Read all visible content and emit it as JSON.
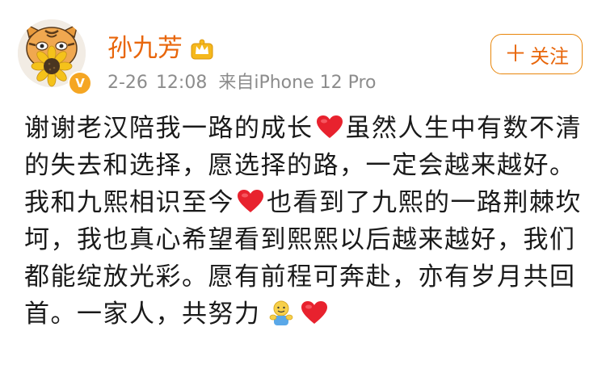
{
  "post": {
    "user": {
      "name": "孙九芳",
      "badge_icon": "crown-icon",
      "verified_icon": "v-badge-icon",
      "verified_label": "V"
    },
    "meta": {
      "date": "2-26",
      "time": "12:08",
      "source": "来自iPhone 12 Pro"
    },
    "follow_button": {
      "plus": "＋",
      "label": "关注"
    },
    "content": {
      "para1_a": "谢谢老汉陪我一路的成长",
      "para1_b": "虽然人生中有数不清的失去和选择，愿选择的路，一定会越来越好。",
      "para2_a": "我和九熙相识至今",
      "para2_b": "也看到了九熙的一路荆棘坎坷，我也真心希望看到熙熙以后越来越好，我们都能绽放光彩。愿有前程可奔赴，亦有岁月共回首。一家人，共努力",
      "emoji": [
        "heart-emoji",
        "heart-emoji",
        "hug-emoji",
        "heart-emoji"
      ]
    },
    "colors": {
      "username": "#e8660b",
      "follow_border": "#e8860b",
      "meta_text": "#8c8c8c",
      "body_text": "#1a1a1a",
      "heart": "#e8222e"
    }
  }
}
